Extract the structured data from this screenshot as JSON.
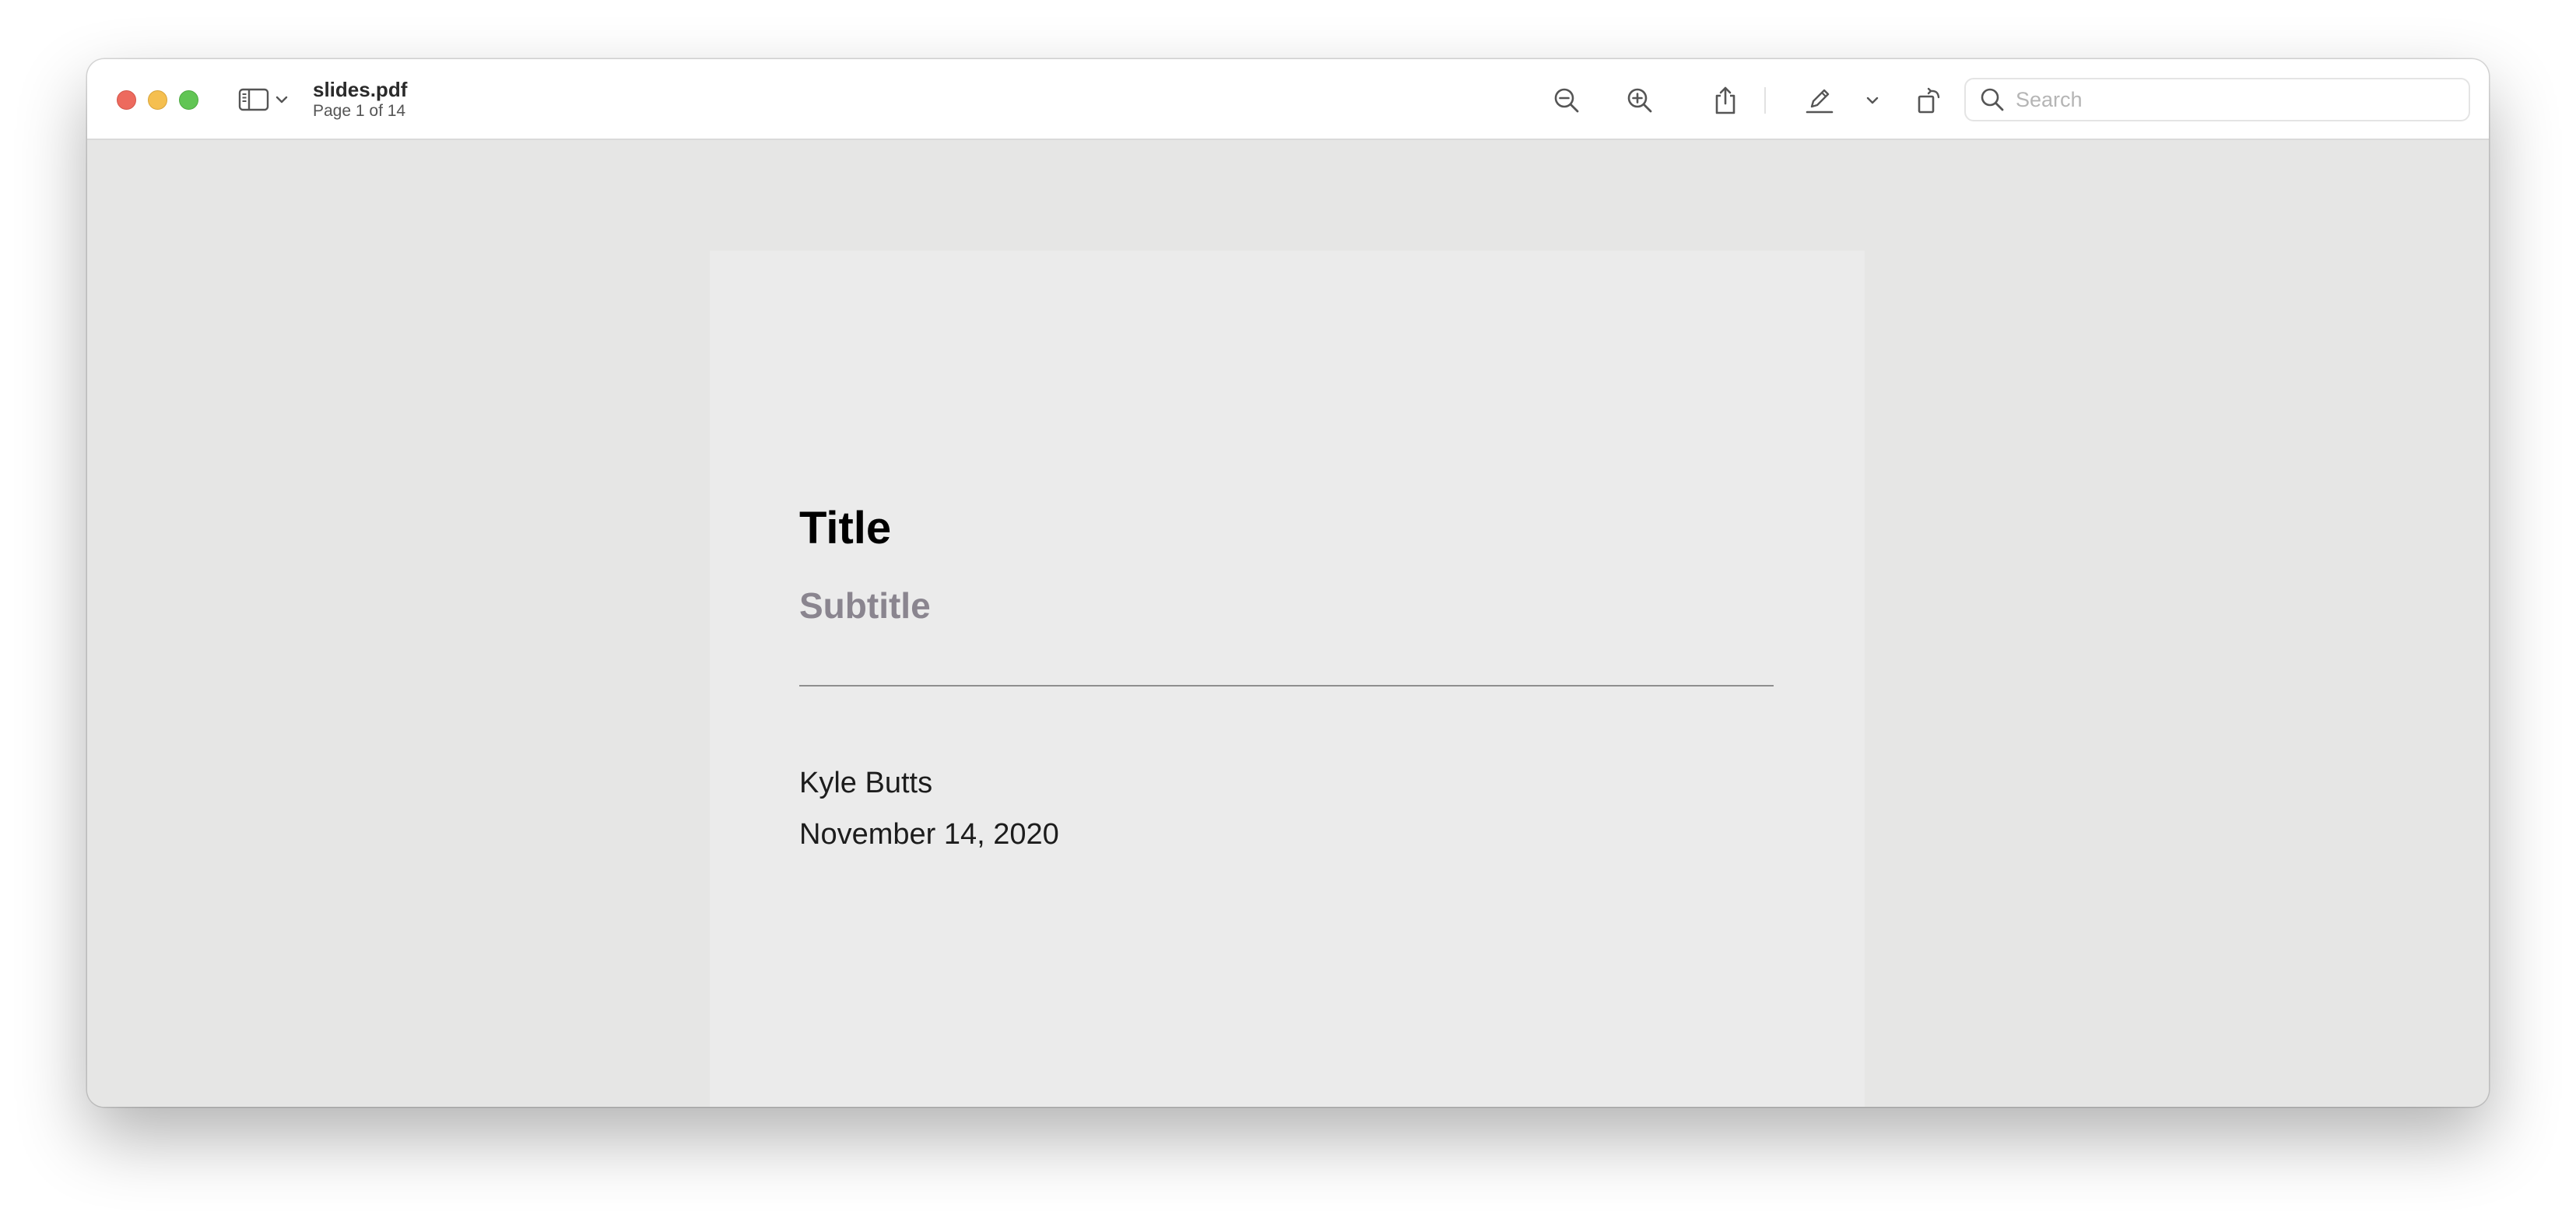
{
  "window": {
    "document_name": "slides.pdf",
    "page_indicator": "Page 1 of 14"
  },
  "toolbar": {
    "buttons": [
      {
        "name": "zoom-out",
        "icon": "zoom-out-icon"
      },
      {
        "name": "zoom-in",
        "icon": "zoom-in-icon"
      },
      {
        "name": "share",
        "icon": "share-icon"
      },
      {
        "name": "highlight",
        "icon": "pencil-icon"
      },
      {
        "name": "highlight-options",
        "icon": "chevron-down-icon"
      },
      {
        "name": "rotate",
        "icon": "rotate-icon"
      },
      {
        "name": "markup",
        "icon": "markup-icon"
      }
    ],
    "search": {
      "placeholder": "Search",
      "value": ""
    }
  },
  "slide": {
    "title": "Title",
    "subtitle": "Subtitle",
    "author": "Kyle Butts",
    "date": "November 14, 2020"
  },
  "colors": {
    "close": "#ed6a5e",
    "minimize": "#f5bf4f",
    "zoom": "#61c554",
    "content_background": "#e6e6e5",
    "page_background": "#ebebeb",
    "subtitle": "#8a858f"
  }
}
